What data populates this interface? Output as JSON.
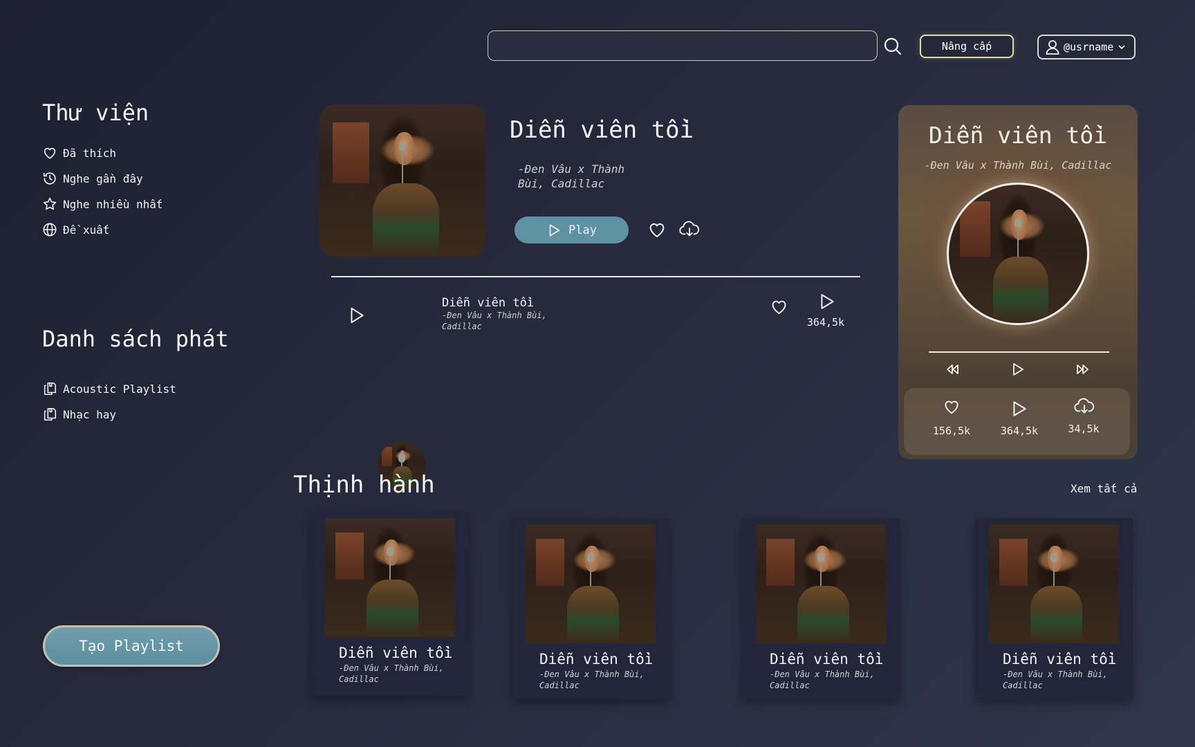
{
  "topbar": {
    "search_placeholder": "",
    "upgrade_label": "Nâng cấp",
    "username": "@usrname"
  },
  "library": {
    "title": "Thư viện",
    "items": [
      {
        "label": "Đã thích",
        "icon": "heart-icon"
      },
      {
        "label": "Nghe gần đây",
        "icon": "history-icon"
      },
      {
        "label": "Nghe nhiều nhất",
        "icon": "star-icon"
      },
      {
        "label": "Đề xuất",
        "icon": "globe-icon"
      }
    ]
  },
  "playlists": {
    "title": "Danh sách phát",
    "items": [
      {
        "label": "Acoustic Playlist",
        "icon": "playlist-icon"
      },
      {
        "label": "Nhạc hay",
        "icon": "playlist-icon"
      }
    ],
    "create_label": "Tạo Playlist"
  },
  "featured": {
    "title": "Diễn viên tồi",
    "artist": "-Đen Vâu x Thành Bùi, Cadillac",
    "play_label": "Play"
  },
  "track_row": {
    "title": "Diễn viên tồi",
    "artist": "-Đen Vâu x Thành Bùi, Cadillac",
    "plays": "364,5k"
  },
  "now_playing": {
    "title": "Diễn viên tồi",
    "artist": "-Đen Vâu x Thành Bùi, Cadillac",
    "likes": "156,5k",
    "plays": "364,5k",
    "downloads": "34,5k"
  },
  "trending": {
    "title": "Thịnh hành",
    "see_all": "Xem tất cả",
    "cards": [
      {
        "title": "Diễn viên tồi",
        "artist": "-Đen Vâu x Thành Bùi, Cadillac"
      },
      {
        "title": "Diễn viên tồi",
        "artist": "-Đen Vâu x Thành Bùi, Cadillac"
      },
      {
        "title": "Diễn viên tồi",
        "artist": "-Đen Vâu x Thành Bùi, Cadillac"
      },
      {
        "title": "Diễn viên tồi",
        "artist": "-Đen Vâu x Thành Bùi, Cadillac"
      }
    ]
  },
  "colors": {
    "background": "#262a3c",
    "accent": "#5e92a3",
    "upgrade_border": "#e4dba3",
    "card": "#23263a"
  }
}
